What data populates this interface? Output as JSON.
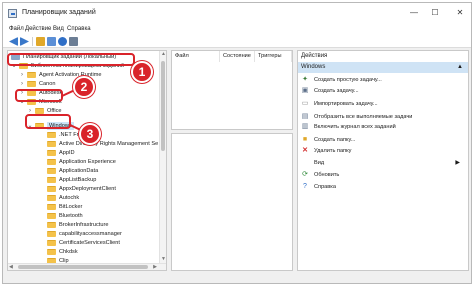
{
  "window": {
    "title": "Планировщик заданий"
  },
  "window_controls": {
    "minimize": "—",
    "maximize": "☐",
    "close": "✕"
  },
  "menu": [
    "Файл",
    "Действие",
    "Вид",
    "Справка"
  ],
  "toolbar": {
    "buttons": [
      "back-icon",
      "forward-icon",
      "folder-icon",
      "properties-icon",
      "help-icon",
      "console-icon"
    ],
    "colors": [
      "#3a78c9",
      "#3a78c9",
      "#e0a82a",
      "#5b8fd6",
      "#2f6fc7",
      "#6c7e95"
    ]
  },
  "tree": {
    "root": "Планировщик заданий (Локальный)",
    "library": "Библиотека планировщика заданий",
    "hidden_item": "Agent Activation Runtime",
    "canon": "Canon",
    "covered": "Autodesk",
    "microsoft": "Microsoft",
    "office": "Office",
    "windows": "Windows",
    "net_framework": ".NET Framework",
    "rights_mgmt": "Active Directory Rights Management Se",
    "items": [
      "AppID",
      "Application Experience",
      "ApplicationData",
      "AppListBackup",
      "AppxDeploymentClient",
      "Autochk",
      "BitLocker",
      "Bluetooth",
      "BrokerInfrastructure",
      "capabilityaccessmanager",
      "CertificateServicesClient",
      "Chkdsk",
      "Clip"
    ]
  },
  "list": {
    "columns": [
      "Файл",
      "Состояние",
      "Триггеры"
    ]
  },
  "actions": {
    "header": "Действия",
    "group": "Windows",
    "items": [
      {
        "icon": "create-task-icon",
        "label": "Создать простую задачу..."
      },
      {
        "icon": "new-task-icon",
        "label": "Создать задачу..."
      },
      {
        "icon": "import-icon",
        "label": "Импортировать задачу..."
      },
      {
        "icon": "running-tasks-icon",
        "label": "Отобразить все выполняемые задачи"
      },
      {
        "icon": "history-icon",
        "label": "Включить журнал всех заданий"
      },
      {
        "icon": "new-folder-icon",
        "label": "Создать папку..."
      },
      {
        "icon": "delete-icon",
        "label": "Удалить папку"
      },
      {
        "icon": "view-icon",
        "label": "Вид"
      },
      {
        "icon": "refresh-icon",
        "label": "Обновить"
      },
      {
        "icon": "help-icon",
        "label": "Справка"
      }
    ],
    "submenu_arrow": "▶",
    "collapse_caret": "▲"
  },
  "annotations": {
    "badges": [
      "1",
      "2",
      "3"
    ],
    "color": "#d9232a"
  },
  "scroll": {
    "up": "▲",
    "down": "▼",
    "left": "◀",
    "right": "▶"
  },
  "tree_glyphs": {
    "expanded": "⌄",
    "collapsed": "›"
  }
}
